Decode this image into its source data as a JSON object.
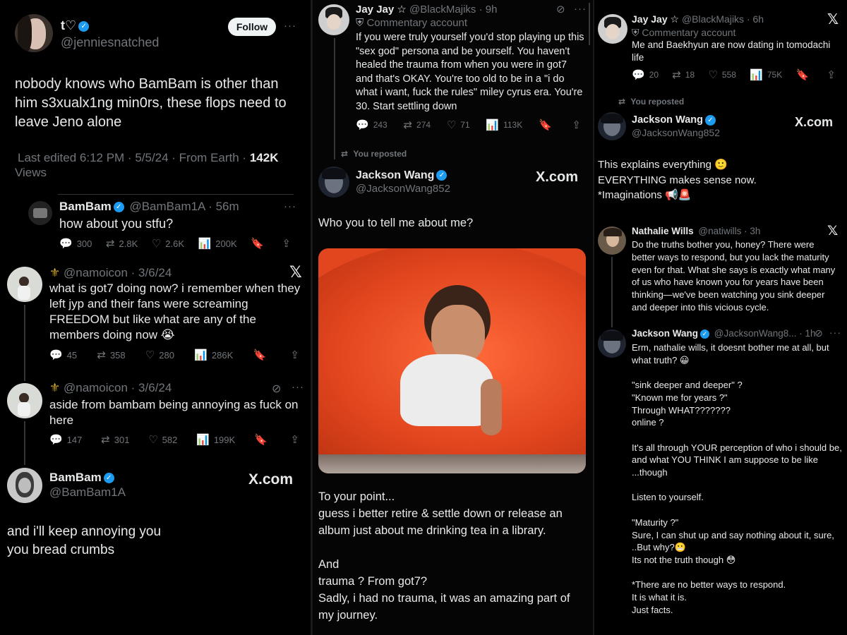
{
  "col1": {
    "main_tweet": {
      "name": "t♡",
      "handle": "@jenniesnatched",
      "follow_label": "Follow",
      "more": "···",
      "text": "nobody knows who BamBam is other than him s3xualx1ng min0rs, these flops need to leave Jeno alone",
      "meta": "Last edited 6:12 PM · 5/5/24 · From Earth ·",
      "views_count": "142K",
      "views_label": "Views"
    },
    "reply1": {
      "name": "BamBam",
      "handle": "@BamBam1A · 56m",
      "more": "···",
      "text": "how about you stfu?",
      "replies": "300",
      "retweets": "2.8K",
      "likes": "2.6K",
      "views": "200K"
    },
    "reply2": {
      "emoji": "⚜",
      "handle": "@namoicon · 3/6/24",
      "text": "what is got7 doing now? i remember when they left jyp and their fans were screaming FREEDOM but like what are any of the members doing now 😭",
      "replies": "45",
      "retweets": "358",
      "likes": "280",
      "views": "286K"
    },
    "reply3": {
      "emoji": "⚜",
      "handle": "@namoicon · 3/6/24",
      "more": "···",
      "text": "aside from bambam being annoying as fuck on here",
      "replies": "147",
      "retweets": "301",
      "likes": "582",
      "views": "199K"
    },
    "bambam_post": {
      "name": "BamBam",
      "handle": "@BamBam1A",
      "site": "X.com",
      "text": "and i'll keep annoying you\nyou bread crumbs"
    }
  },
  "col2": {
    "quoted": {
      "name": "Jay Jay ☆",
      "handle": "@BlackMajiks · 9h",
      "more": "···",
      "commentary": "Commentary account",
      "text": "If you were truly yourself you'd stop playing up this \"sex god\" persona and be yourself. You haven't healed the trauma from when you were in got7 and that's OKAY. You're too old to be in a \"i do what i want, fuck the rules\" miley cyrus era. You're 30. Start settling down",
      "replies": "243",
      "retweets": "274",
      "likes": "71",
      "views": "113K"
    },
    "reposted_label": "You reposted",
    "jackson": {
      "name": "Jackson Wang",
      "handle": "@JacksonWang852",
      "site": "X.com",
      "text": "Who you to tell me about me?",
      "text2": "To your point...\nguess i better retire & settle down or release an album just about me drinking tea in a library.\n\nAnd\ntrauma ? From got7?\nSadly, i had no trauma, it was an amazing part of my journey."
    }
  },
  "col3": {
    "quoted": {
      "name": "Jay Jay ☆",
      "handle": "@BlackMajiks · 6h",
      "commentary": "Commentary account",
      "text": "Me and Baekhyun are now dating in tomodachi life",
      "replies": "20",
      "retweets": "18",
      "likes": "558",
      "views": "75K"
    },
    "reposted_label": "You reposted",
    "jackson": {
      "name": "Jackson Wang",
      "handle": "@JacksonWang852",
      "site": "X.com",
      "text": "This explains everything 🙂\nEVERYTHING makes sense now.\n*Imaginations 📢🚨"
    },
    "nathalie": {
      "name": "Nathalie Wills",
      "handle": "@natiwills · 3h",
      "text": "Do the truths bother you, honey? There were better ways to respond, but you lack the maturity even for that. What she says is exactly what many of us who have known you for years have been thinking—we've been watching you sink deeper and deeper into this vicious cycle."
    },
    "jackson_reply": {
      "name": "Jackson Wang",
      "handle": "@JacksonWang8... · 1h",
      "text": "Erm, nathalie wills, it doesnt bother me at all, but what truth? 😀\n\n\"sink deeper and deeper\" ?\n\"Known me for years ?\"\nThrough WHAT???????\nonline ?\n\nIt's all through YOUR perception of who i should be, and what YOU THINK I am suppose to be like ...though\n\nListen to yourself.\n\n\"Maturity ?\"\nSure, I can shut up and say nothing about it, sure,\n..But why?😬\nIts not the truth though 😳\n\n*There are no better ways to respond.\nIt is what it is.\nJust facts."
    }
  },
  "icons": {
    "reply": "💬",
    "retweet": "⇄",
    "like": "♡",
    "views": "📊",
    "bookmark": "🔖",
    "share": "⇪"
  },
  "x_logo": "𝕏",
  "colors": {
    "verified": "#1d9bf0",
    "text": "#e7e9ea",
    "muted": "#71767b",
    "slide": "#e2461f"
  }
}
